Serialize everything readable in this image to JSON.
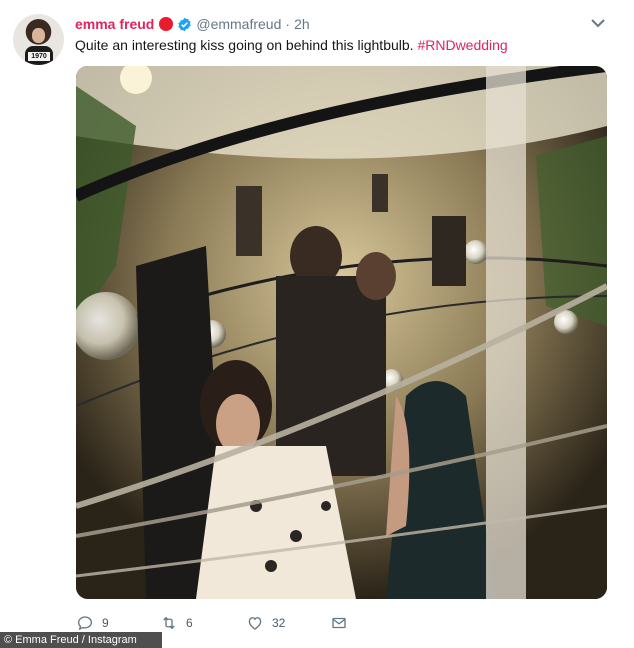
{
  "tweet": {
    "display_name": "emma freud",
    "handle": "@emmafreud",
    "separator": "·",
    "time": "2h",
    "text": "Quite an interesting kiss going on behind this lightbulb.",
    "hashtag": "#RNDwedding",
    "avatar_badge": "1970"
  },
  "actions": {
    "replies": "9",
    "retweets": "6",
    "likes": "32"
  },
  "credit": "© Emma Freud / Instagram",
  "colors": {
    "name": "#e0245e",
    "red_dot": "#e81c2e",
    "verified": "#1da1f2",
    "muted": "#657786"
  },
  "icons": [
    "red-circle-icon",
    "verified-icon",
    "chevron-down-icon",
    "reply-icon",
    "retweet-icon",
    "like-icon",
    "direct-message-icon"
  ]
}
